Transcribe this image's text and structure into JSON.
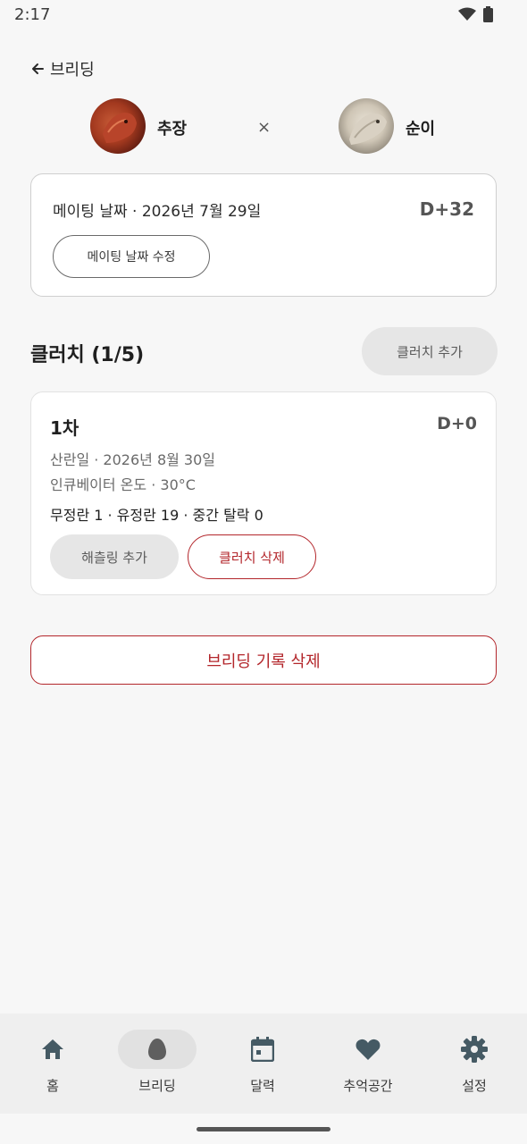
{
  "status_bar": {
    "time": "2:17"
  },
  "header": {
    "back_label": "브리딩"
  },
  "pair": {
    "male": {
      "name": "추장"
    },
    "separator": "×",
    "female": {
      "name": "순이"
    }
  },
  "mating": {
    "label": "메이팅 날짜 · 2026년 7월 29일",
    "dday": "D+32",
    "edit_button": "메이팅 날짜 수정"
  },
  "clutch_section": {
    "title": "클러치 (1/5)",
    "add_button": "클러치 추가"
  },
  "clutches": [
    {
      "round": "1차",
      "dday": "D+0",
      "laying_date": "산란일 · 2026년 8월 30일",
      "incubator_temp": "인큐베이터 온도 · 30°C",
      "egg_counts": "무정란 1 · 유정란 19 · 중간 탈락 0",
      "hatch_button": "해츨링 추가",
      "delete_button": "클러치 삭제"
    }
  ],
  "delete_breeding_button": "브리딩 기록 삭제",
  "bottom_nav": {
    "items": [
      {
        "label": "홈",
        "icon": "home-icon"
      },
      {
        "label": "브리딩",
        "icon": "egg-icon",
        "active": true
      },
      {
        "label": "달력",
        "icon": "calendar-icon"
      },
      {
        "label": "추억공간",
        "icon": "heart-icon"
      },
      {
        "label": "설정",
        "icon": "gear-icon"
      }
    ]
  },
  "colors": {
    "accent_red": "#b3262b",
    "background": "#f7f7f7",
    "nav_background": "#efefef"
  }
}
